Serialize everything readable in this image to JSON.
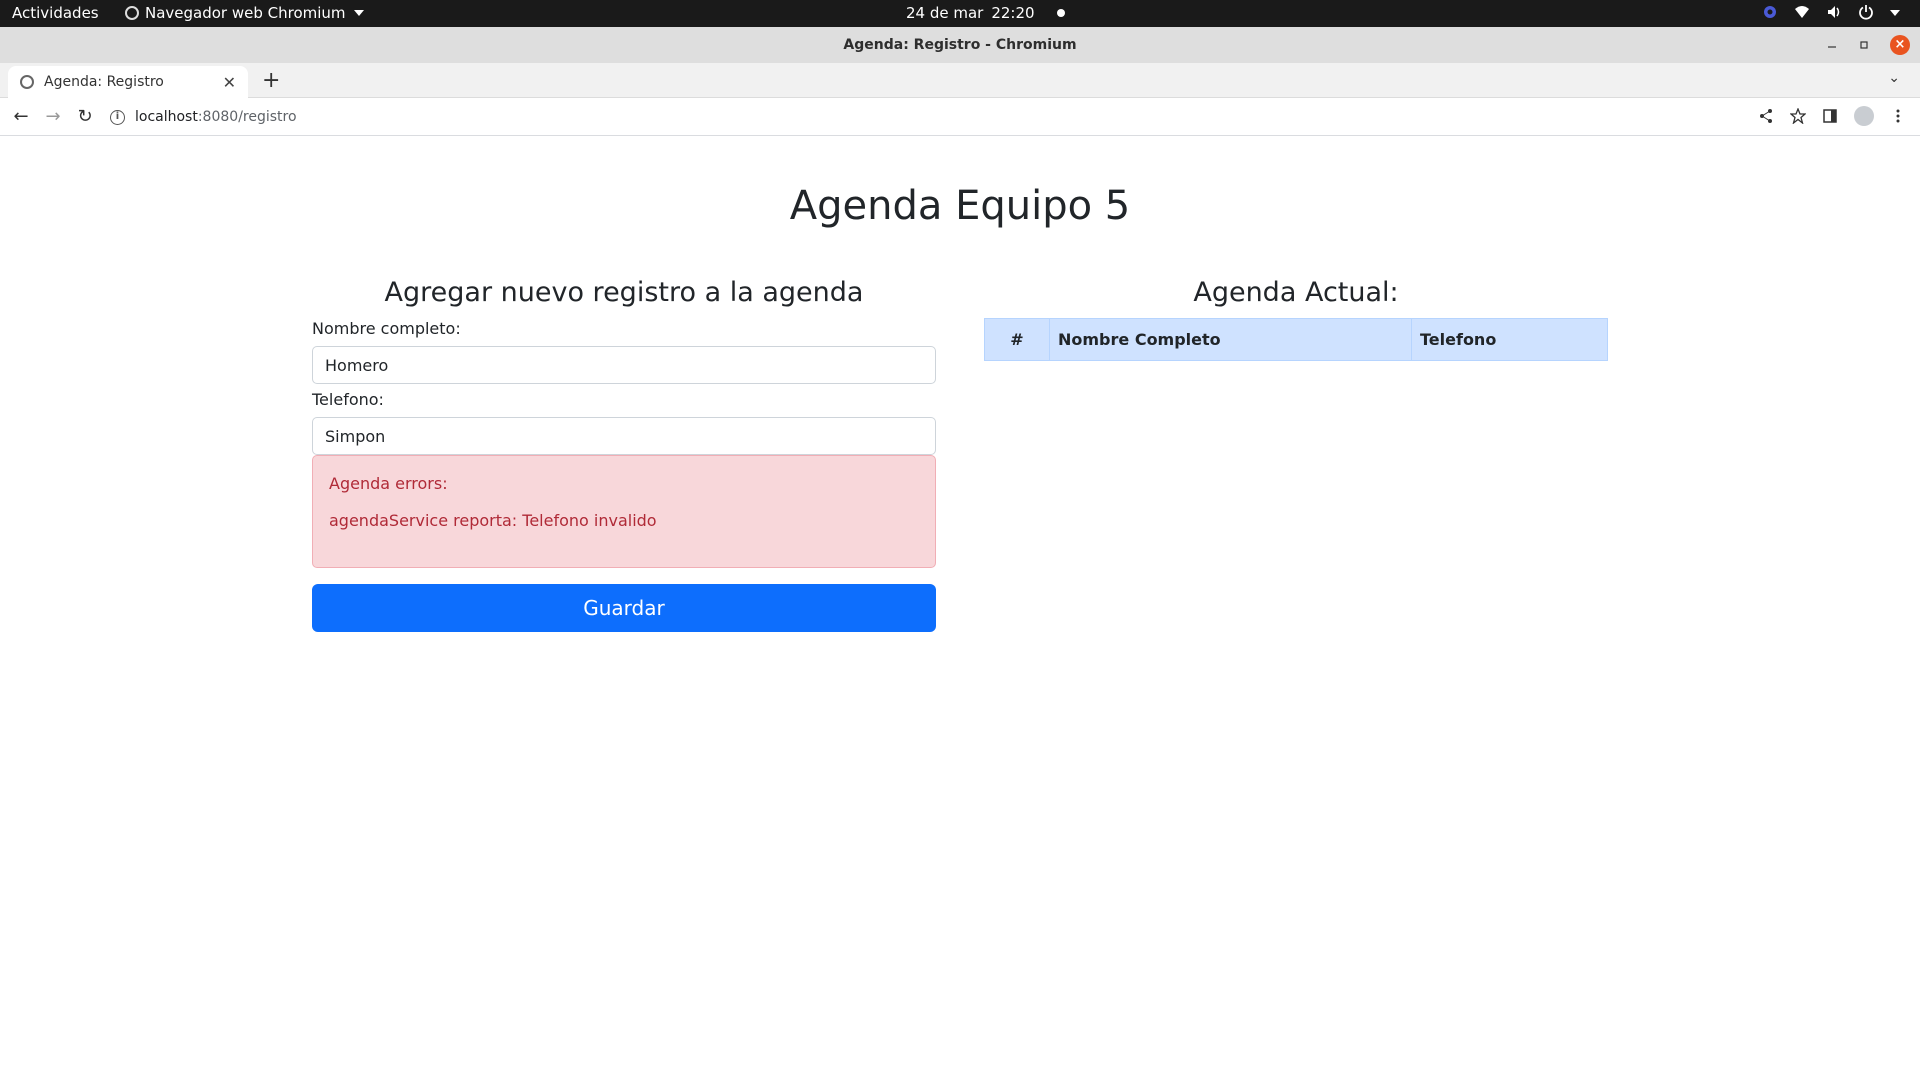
{
  "system_bar": {
    "activities": "Actividades",
    "app_menu": "Navegador web Chromium",
    "date": "24 de mar",
    "time": "22:20"
  },
  "window": {
    "title": "Agenda: Registro - Chromium"
  },
  "tabs": [
    {
      "label": "Agenda: Registro",
      "active": true
    }
  ],
  "address_bar": {
    "host": "localhost",
    "rest": ":8080/registro"
  },
  "page": {
    "title": "Agenda Equipo 5",
    "form": {
      "heading": "Agregar nuevo registro a la agenda",
      "name_label": "Nombre completo:",
      "name_value": "Homero",
      "phone_label": "Telefono:",
      "phone_value": "Simpon",
      "errors_title": "Agenda errors:",
      "errors": [
        "agendaService reporta: Telefono invalido"
      ],
      "save_label": "Guardar"
    },
    "agenda": {
      "heading": "Agenda Actual:",
      "columns": [
        "#",
        "Nombre Completo",
        "Telefono"
      ],
      "rows": []
    }
  },
  "colors": {
    "primary": "#0d6efd",
    "alert_bg": "#f8d7da",
    "alert_text": "#b02a37",
    "table_header": "#cfe2ff",
    "ubuntu_close": "#e95420"
  }
}
